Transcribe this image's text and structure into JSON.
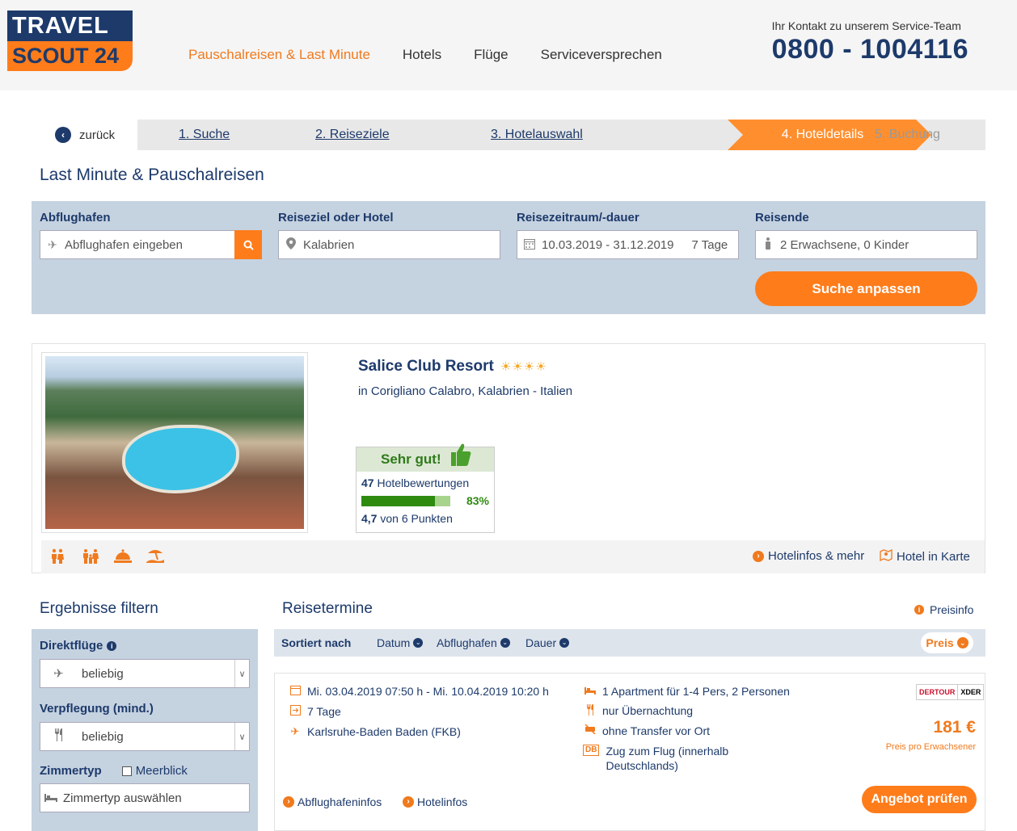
{
  "header": {
    "logo_top": "TRAVEL",
    "logo_bottom": "SCOUT 24",
    "nav": [
      "Pauschalreisen & Last Minute",
      "Hotels",
      "Flüge",
      "Serviceversprechen"
    ],
    "contact_label": "Ihr Kontakt zu unserem Service-Team",
    "contact_phone": "0800 - 1004116"
  },
  "steps": {
    "back": "zurück",
    "items": [
      "1. Suche",
      "2. Reiseziele",
      "3. Hotelauswahl",
      "4. Hoteldetails",
      "5. Buchung"
    ],
    "active_index": 3
  },
  "page_title": "Last Minute & Pauschalreisen",
  "search": {
    "airport_label": "Abflughafen",
    "airport_placeholder": "Abflughafen eingeben",
    "dest_label": "Reiseziel oder Hotel",
    "dest_value": "Kalabrien",
    "period_label": "Reisezeitraum/-dauer",
    "period_value": "10.03.2019 - 31.12.2019",
    "duration_value": "7 Tage",
    "travelers_label": "Reisende",
    "travelers_value": "2 Erwachsene, 0 Kinder",
    "submit": "Suche anpassen"
  },
  "hotel": {
    "name": "Salice Club Resort",
    "stars": "☀☀☀☀",
    "location": "in Corigliano Calabro, Kalabrien - Italien",
    "rating_label": "Sehr gut!",
    "reviews_count": "47",
    "reviews_label": "Hotelbewertungen",
    "recommend_fraction": 0.83,
    "recommend_pct": "83%",
    "score": "4,7",
    "score_label": "von 6 Punkten",
    "link_info": "Hotelinfos & mehr",
    "link_map": "Hotel in Karte"
  },
  "filter": {
    "title": "Ergebnisse filtern",
    "direct_label": "Direktflüge",
    "direct_value": "beliebig",
    "board_label": "Verpflegung (mind.)",
    "board_value": "beliebig",
    "room_label": "Zimmertyp",
    "seaview_label": "Meerblick",
    "room_placeholder": "Zimmertyp auswählen"
  },
  "results": {
    "title": "Reisetermine",
    "preisinfo": "Preisinfo",
    "sort_label": "Sortiert nach",
    "sort_items": [
      "Datum",
      "Abflughafen",
      "Dauer"
    ],
    "sort_price": "Preis"
  },
  "offer": {
    "dates": "Mi. 03.04.2019 07:50 h - Mi. 10.04.2019 10:20 h",
    "duration": "7 Tage",
    "airport": "Karlsruhe-Baden Baden (FKB)",
    "room": "1 Apartment für 1-4 Pers, 2 Personen",
    "board": "nur Übernachtung",
    "transfer": "ohne Transfer vor Ort",
    "rail_badge": "DB",
    "rail_line1": "Zug zum Flug (innerhalb",
    "rail_line2": "Deutschlands)",
    "operator_1": "DERTOUR",
    "operator_2": "XDER",
    "price": "181 €",
    "price_note": "Preis pro Erwachsener",
    "link_airport": "Abflughafeninfos",
    "link_hotel": "Hotelinfos",
    "cta": "Angebot prüfen"
  }
}
